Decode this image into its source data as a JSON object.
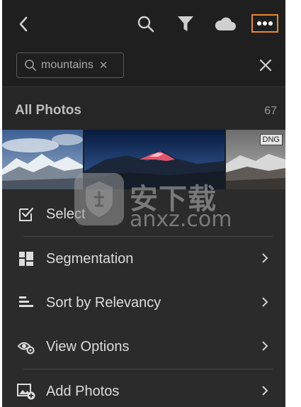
{
  "search": {
    "query": "mountains"
  },
  "album": {
    "title": "All Photos",
    "count": "67"
  },
  "photos": [
    {
      "name": "photo-1"
    },
    {
      "name": "photo-2"
    },
    {
      "name": "photo-3",
      "badge": "DNG"
    }
  ],
  "menu": {
    "items": [
      {
        "label": "Select",
        "icon": "checkbox-icon",
        "chevron": false
      },
      {
        "label": "Segmentation",
        "icon": "grid-icon",
        "chevron": true
      },
      {
        "label": "Sort by Relevancy",
        "icon": "sort-icon",
        "chevron": true
      },
      {
        "label": "View Options",
        "icon": "eye-gear-icon",
        "chevron": true
      },
      {
        "label": "Add Photos",
        "icon": "add-photo-icon",
        "chevron": true
      }
    ]
  },
  "watermark": {
    "cn": "安下载",
    "en": "anxz.com"
  },
  "colors": {
    "accent": "#e8882a",
    "background": "#1f1f1f",
    "menu": "#2b2b2b"
  }
}
